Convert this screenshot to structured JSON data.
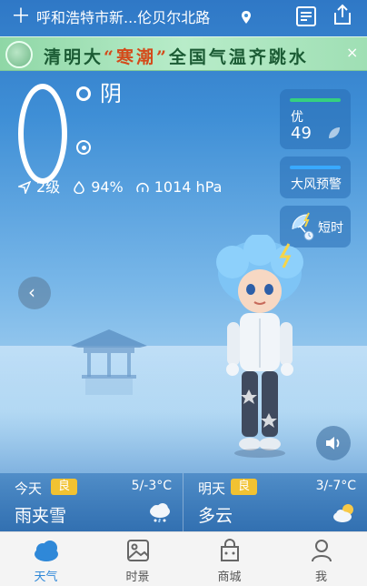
{
  "header": {
    "add_icon": "plus-icon",
    "location": "呼和浩特市新...伦贝尔北路",
    "location_pin_icon": "location-pin-icon",
    "news_icon": "news-list-icon",
    "share_icon": "share-icon"
  },
  "banner": {
    "text_before": "清明大",
    "highlight": "“寒潮”",
    "text_after": "全国气温齐跳水",
    "close": "×"
  },
  "current": {
    "temperature": "0",
    "condition": "阴",
    "wind": "2级",
    "humidity": "94%",
    "pressure": "1014 hPa"
  },
  "air_quality": {
    "level": "优",
    "value": "49",
    "bar_color": "#35d07f"
  },
  "warning": {
    "label": "大风预警",
    "bar_color": "#39a9ff"
  },
  "short_term": {
    "label": "短时"
  },
  "forecast": {
    "today": {
      "day": "今天",
      "aqi": "良",
      "range": "5/-3°C",
      "condition": "雨夹雪",
      "icon": "sleet-icon"
    },
    "tomorrow": {
      "day": "明天",
      "aqi": "良",
      "range": "3/-7°C",
      "condition": "多云",
      "icon": "partly-cloudy-icon"
    }
  },
  "nav": {
    "items": [
      {
        "label": "天气",
        "icon": "weather-icon",
        "active": true
      },
      {
        "label": "时景",
        "icon": "photo-icon",
        "active": false
      },
      {
        "label": "商城",
        "icon": "shop-icon",
        "active": false
      },
      {
        "label": "我",
        "icon": "profile-icon",
        "active": false
      }
    ]
  },
  "colors": {
    "accent": "#2f88d8",
    "badge": "#f1c232",
    "banner_highlight": "#d44a1a"
  }
}
